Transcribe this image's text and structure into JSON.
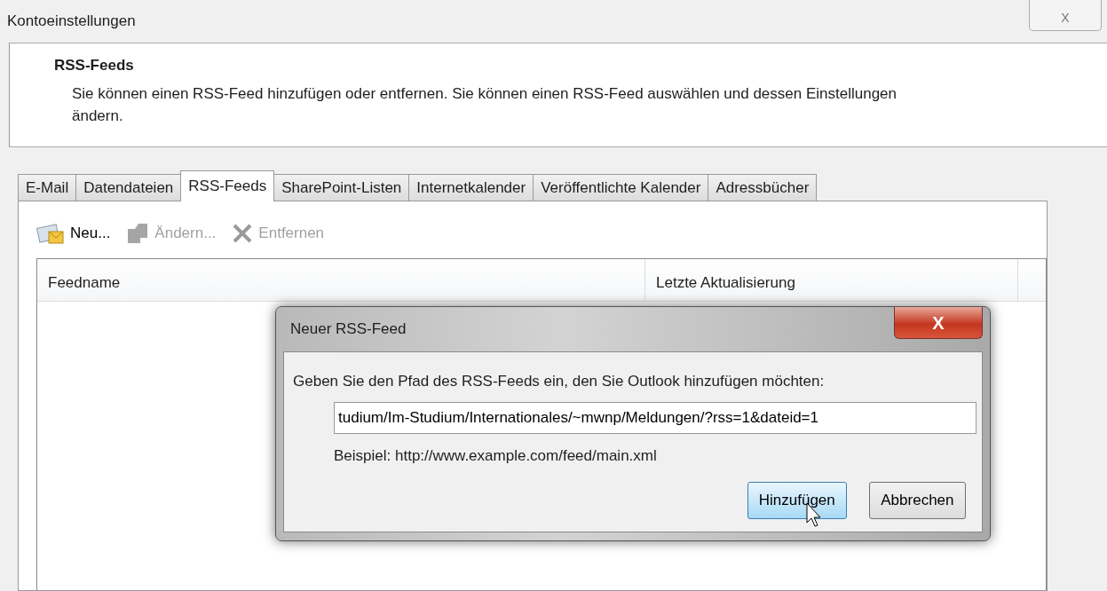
{
  "window": {
    "title": "Kontoeinstellungen",
    "close_label": "X"
  },
  "header": {
    "title": "RSS-Feeds",
    "description": "Sie können einen RSS-Feed hinzufügen oder entfernen. Sie können einen RSS-Feed auswählen und dessen Einstellungen ändern."
  },
  "tabs": [
    {
      "label": "E-Mail",
      "selected": false
    },
    {
      "label": "Datendateien",
      "selected": false
    },
    {
      "label": "RSS-Feeds",
      "selected": true
    },
    {
      "label": "SharePoint-Listen",
      "selected": false
    },
    {
      "label": "Internetkalender",
      "selected": false
    },
    {
      "label": "Veröffentlichte Kalender",
      "selected": false
    },
    {
      "label": "Adressbücher",
      "selected": false
    }
  ],
  "toolbar": [
    {
      "kind": "new",
      "label": "Neu...",
      "disabled": false
    },
    {
      "kind": "edit",
      "label": "Ändern...",
      "disabled": true
    },
    {
      "kind": "remove",
      "label": "Entfernen",
      "disabled": true
    }
  ],
  "table": {
    "columns": [
      "Feedname",
      "Letzte Aktualisierung"
    ]
  },
  "dialog": {
    "title": "Neuer RSS-Feed",
    "close_label": "X",
    "prompt": "Geben Sie den Pfad des RSS-Feeds ein, den Sie Outlook hinzufügen möchten:",
    "value": "tudium/Im-Studium/Internationales/~mwnp/Meldungen/?rss=1&dateid=1",
    "example": "Beispiel: http://www.example.com/feed/main.xml",
    "buttons": [
      {
        "label": "Hinzufügen",
        "focused": true
      },
      {
        "label": "Abbrechen",
        "focused": false
      }
    ]
  }
}
